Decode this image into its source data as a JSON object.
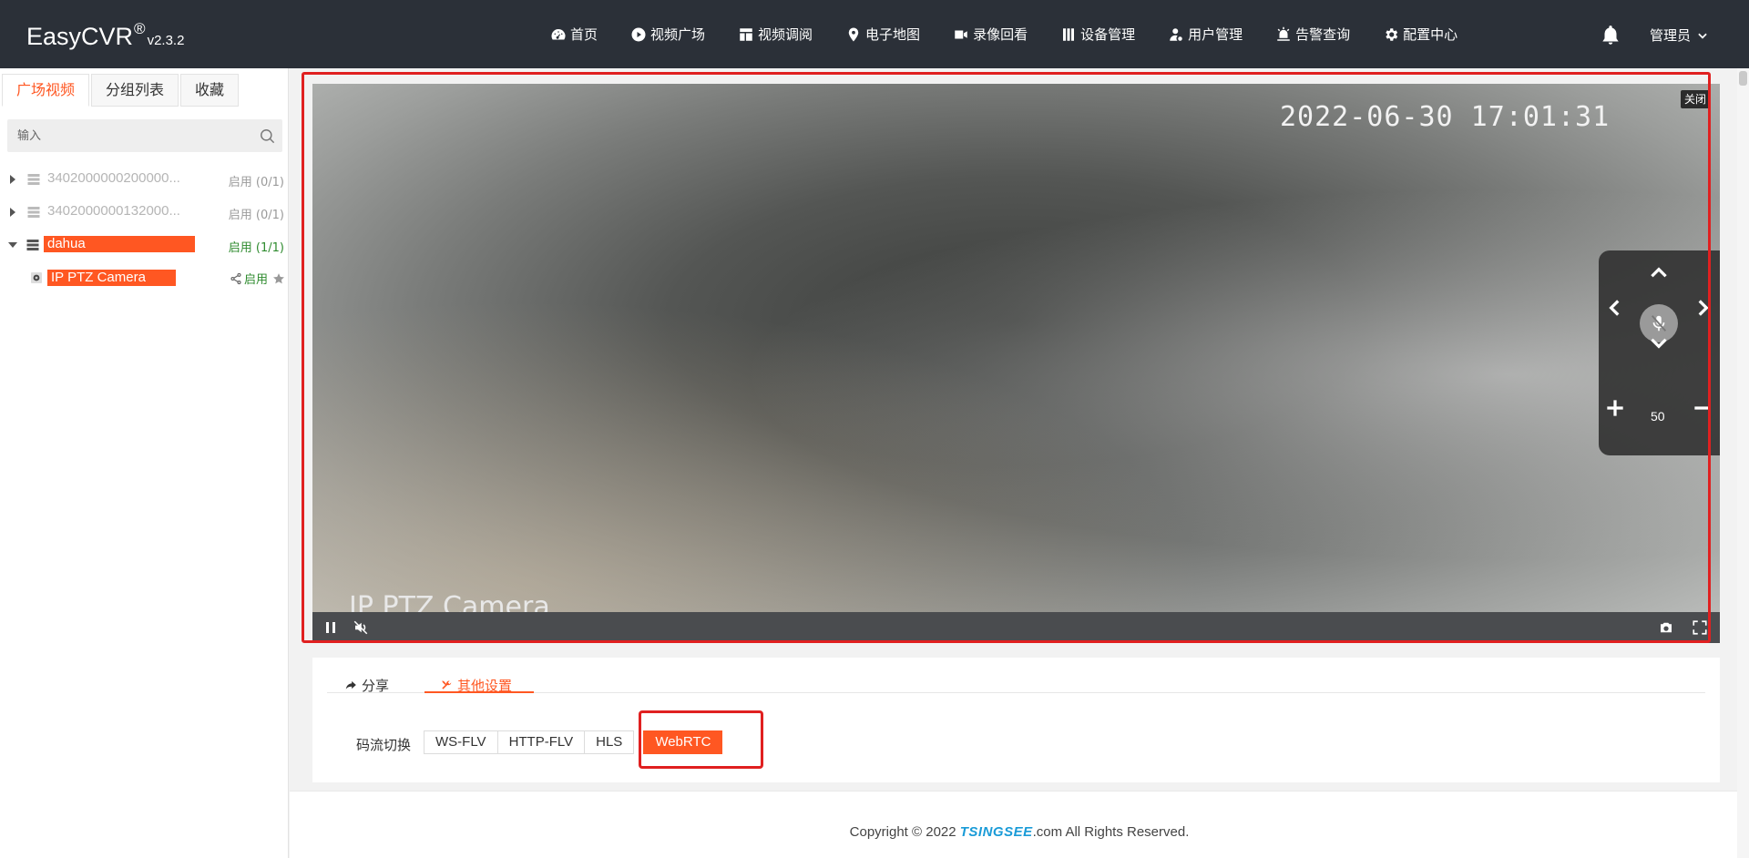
{
  "header": {
    "brand": "EasyCVR",
    "brand_mark": "®",
    "version": "v2.3.2",
    "nav": [
      {
        "label": "首页",
        "icon": "dashboard-icon"
      },
      {
        "label": "视频广场",
        "icon": "play-circle-icon"
      },
      {
        "label": "视频调阅",
        "icon": "layout-icon"
      },
      {
        "label": "电子地图",
        "icon": "map-pin-icon"
      },
      {
        "label": "录像回看",
        "icon": "video-camera-icon"
      },
      {
        "label": "设备管理",
        "icon": "server-icon"
      },
      {
        "label": "用户管理",
        "icon": "user-icon"
      },
      {
        "label": "告警查询",
        "icon": "alarm-icon"
      },
      {
        "label": "配置中心",
        "icon": "gear-icon"
      }
    ],
    "user": "管理员"
  },
  "sidebar": {
    "tabs": [
      "广场视频",
      "分组列表",
      "收藏"
    ],
    "active_tab": "广场视频",
    "search_placeholder": "输入",
    "tree": [
      {
        "label": "3402000000200000...",
        "status": "启用 (0/1)",
        "expanded": false
      },
      {
        "label": "3402000000132000...",
        "status": "启用 (0/1)",
        "expanded": false
      },
      {
        "label": "dahua",
        "status": "启用 (1/1)",
        "expanded": true
      }
    ],
    "camera": {
      "label": "IP PTZ Camera",
      "status": "启用"
    }
  },
  "player": {
    "timestamp": "2022-06-30 17:01:31",
    "osd_name": "IP PTZ Camera",
    "close_label": "关闭",
    "zoom_value": "50"
  },
  "settings": {
    "tabs": [
      "分享",
      "其他设置"
    ],
    "active_tab": "其他设置",
    "stream_label": "码流切换",
    "streams": [
      "WS-FLV",
      "HTTP-FLV",
      "HLS"
    ],
    "active_stream": "WebRTC"
  },
  "footer": {
    "prefix": "Copyright © 2022 ",
    "brand": "TSINGSEE",
    "suffix": ".com All Rights Reserved."
  },
  "colors": {
    "accent": "#ff5722",
    "highlight_box": "#e02020",
    "topbar": "#2b3038"
  }
}
